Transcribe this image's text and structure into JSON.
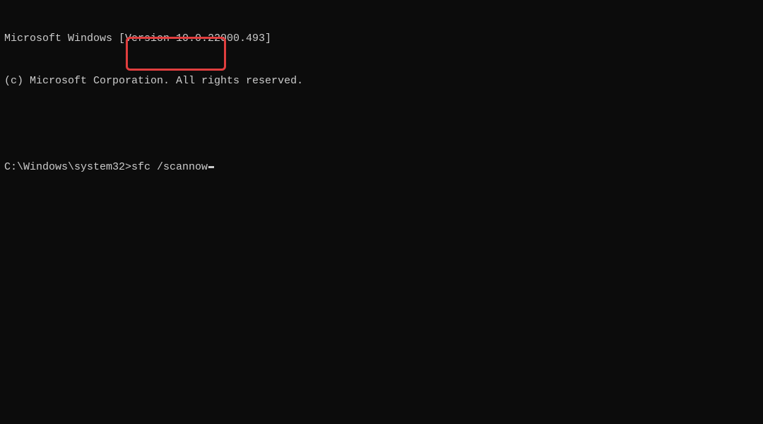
{
  "header": {
    "line1": "Microsoft Windows [Version 10.0.22000.493]",
    "line2": "(c) Microsoft Corporation. All rights reserved."
  },
  "prompt": {
    "path": "C:\\Windows\\system32>",
    "command": "sfc /scannow"
  }
}
